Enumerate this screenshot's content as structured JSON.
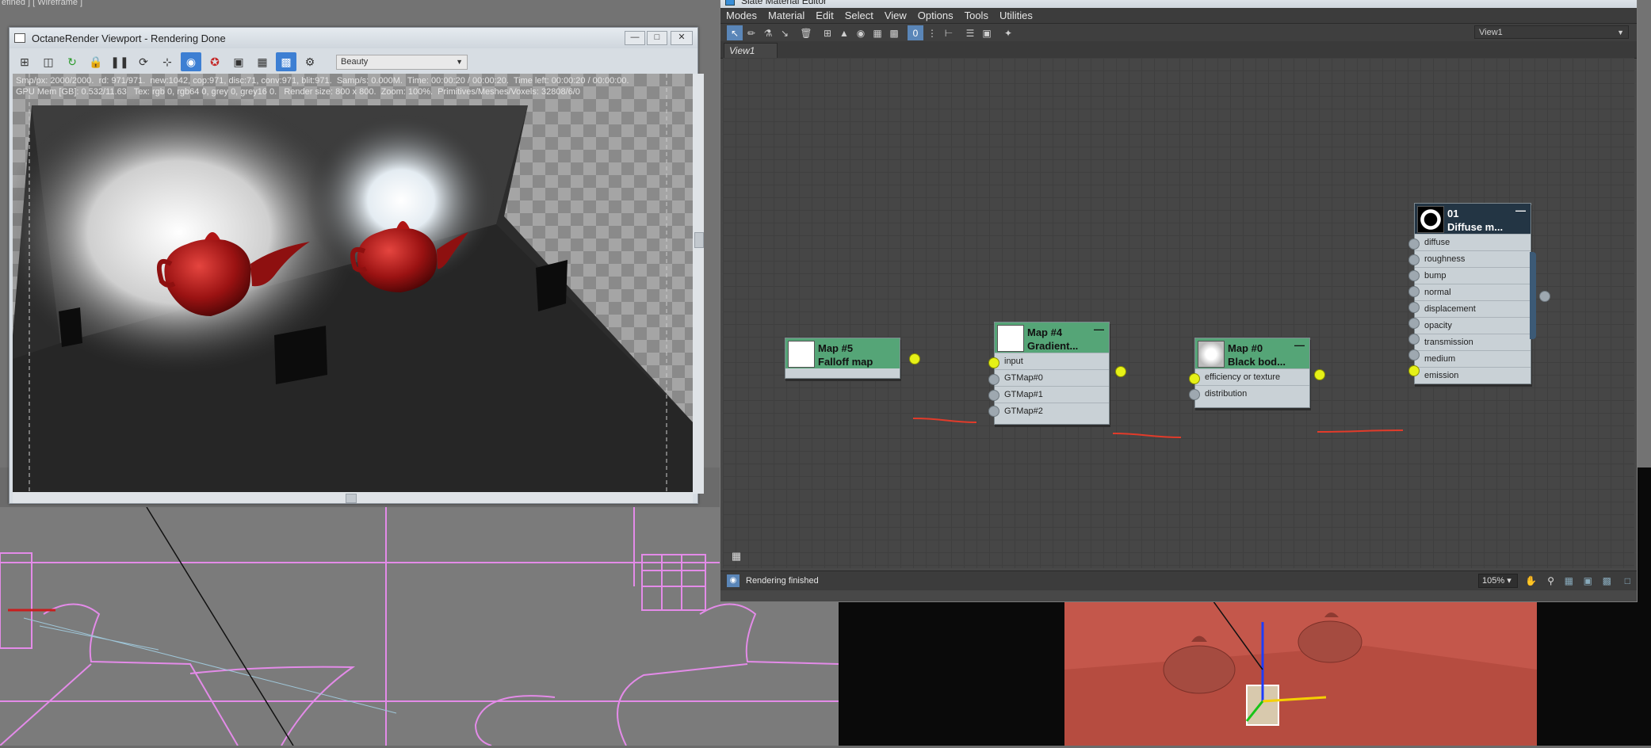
{
  "viewport_label": "efined ] [ Wireframe ]",
  "octane": {
    "title": "OctaneRender Viewport - Rendering Done",
    "pass_select": "Beauty",
    "stats_line1": "Smp/px: 2000/2000.  rd: 971/971.  new:1042, cop:971, disc:71, conv:971, blit:971.  Samp/s: 0.000M.  Time: 00:00:20 / 00:00:20.  Time left: 00:00:20 / 00:00:00.",
    "stats_line2": "GPU Mem [GB]: 0.532/11.63   Tex: rgb 0, rgb64 0, grey 0, grey16 0.   Render size: 800 x 800.  Zoom: 100%.  Primitives/Meshes/Voxels: 32808/6/0"
  },
  "slate": {
    "title": "Slate Material Editor",
    "menus": [
      "Modes",
      "Material",
      "Edit",
      "Select",
      "View",
      "Options",
      "Tools",
      "Utilities"
    ],
    "view_select": "View1",
    "tab": "View1",
    "status": "Rendering finished",
    "zoom": "105%",
    "nodes": {
      "map5": {
        "line1": "Map #5",
        "line2": "Falloff map"
      },
      "map4": {
        "line1": "Map #4",
        "line2": "Gradient...",
        "slots": [
          "input",
          "GTMap#0",
          "GTMap#1",
          "GTMap#2"
        ]
      },
      "map0": {
        "line1": "Map #0",
        "line2": "Black bod...",
        "slots": [
          "efficiency or texture",
          "distribution"
        ]
      },
      "mat01": {
        "line1": "01",
        "line2": "Diffuse m...",
        "slots": [
          "diffuse",
          "roughness",
          "bump",
          "normal",
          "displacement",
          "opacity",
          "transmission",
          "medium",
          "emission"
        ]
      }
    }
  },
  "colors": {
    "node_green": "#55a577",
    "port_active": "#e6f117",
    "wire": "#e23b2a",
    "button_active": "#3d7fd3"
  }
}
